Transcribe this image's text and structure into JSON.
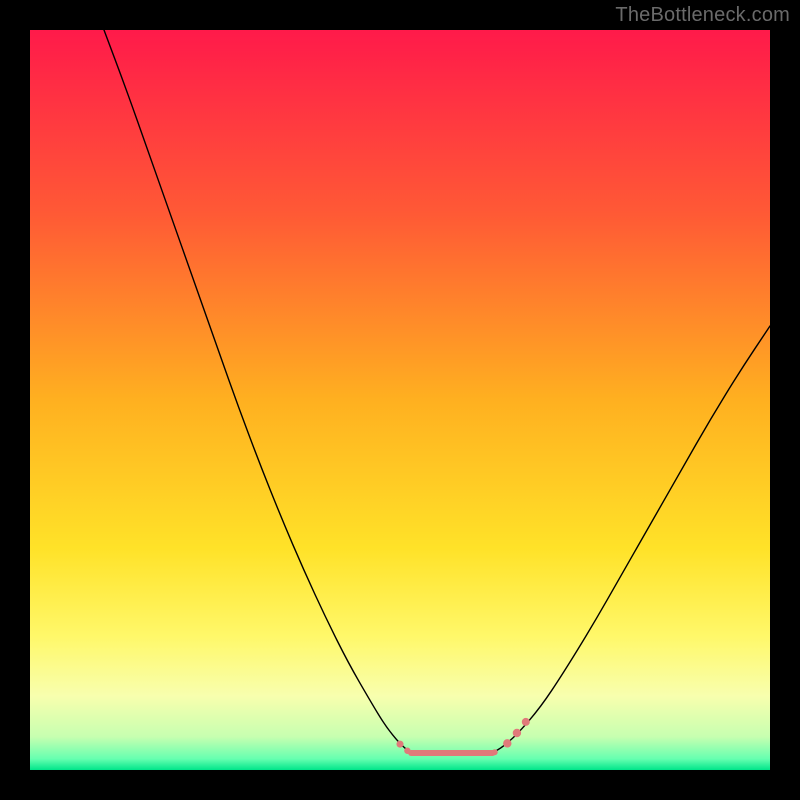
{
  "watermark": "TheBottleneck.com",
  "chart_data": {
    "type": "line",
    "title": "",
    "xlabel": "",
    "ylabel": "",
    "xlim": [
      0,
      100
    ],
    "ylim": [
      0,
      100
    ],
    "background_gradient": {
      "stops": [
        {
          "offset": 0.0,
          "color": "#ff1a4a"
        },
        {
          "offset": 0.25,
          "color": "#ff5a35"
        },
        {
          "offset": 0.5,
          "color": "#ffb020"
        },
        {
          "offset": 0.7,
          "color": "#ffe228"
        },
        {
          "offset": 0.82,
          "color": "#fff86a"
        },
        {
          "offset": 0.9,
          "color": "#f8ffae"
        },
        {
          "offset": 0.955,
          "color": "#c7ffb0"
        },
        {
          "offset": 0.985,
          "color": "#66ffb0"
        },
        {
          "offset": 1.0,
          "color": "#00e58a"
        }
      ]
    },
    "series": [
      {
        "name": "left-curve",
        "type": "line",
        "color": "#000000",
        "width": 1.4,
        "x": [
          10.0,
          13.0,
          16.0,
          19.0,
          22.0,
          25.0,
          28.0,
          31.0,
          34.0,
          37.0,
          40.0,
          43.0,
          46.0,
          48.0,
          50.0,
          51.5
        ],
        "y": [
          100.0,
          92.0,
          83.5,
          75.0,
          66.5,
          58.0,
          49.5,
          41.5,
          34.0,
          27.0,
          20.5,
          14.5,
          9.3,
          6.0,
          3.5,
          2.3
        ]
      },
      {
        "name": "right-curve",
        "type": "line",
        "color": "#000000",
        "width": 1.4,
        "x": [
          62.5,
          64.0,
          66.0,
          69.0,
          72.0,
          76.0,
          80.0,
          84.0,
          88.0,
          92.0,
          96.0,
          100.0
        ],
        "y": [
          2.3,
          3.2,
          5.0,
          8.5,
          13.0,
          19.5,
          26.5,
          33.5,
          40.5,
          47.5,
          54.0,
          60.0
        ]
      },
      {
        "name": "valley-flat",
        "type": "line",
        "color": "#e07a7a",
        "width": 6,
        "x": [
          51.5,
          62.5
        ],
        "y": [
          2.3,
          2.3
        ]
      }
    ],
    "markers": [
      {
        "x": 50.0,
        "y": 3.5,
        "r": 3.5,
        "color": "#e07a7a"
      },
      {
        "x": 51.0,
        "y": 2.6,
        "r": 3.2,
        "color": "#e07a7a"
      },
      {
        "x": 62.8,
        "y": 2.4,
        "r": 3.0,
        "color": "#e07a7a"
      },
      {
        "x": 64.5,
        "y": 3.6,
        "r": 4.2,
        "color": "#e07a7a"
      },
      {
        "x": 65.8,
        "y": 5.0,
        "r": 4.2,
        "color": "#e07a7a"
      },
      {
        "x": 67.0,
        "y": 6.5,
        "r": 4.0,
        "color": "#e07a7a"
      }
    ]
  }
}
